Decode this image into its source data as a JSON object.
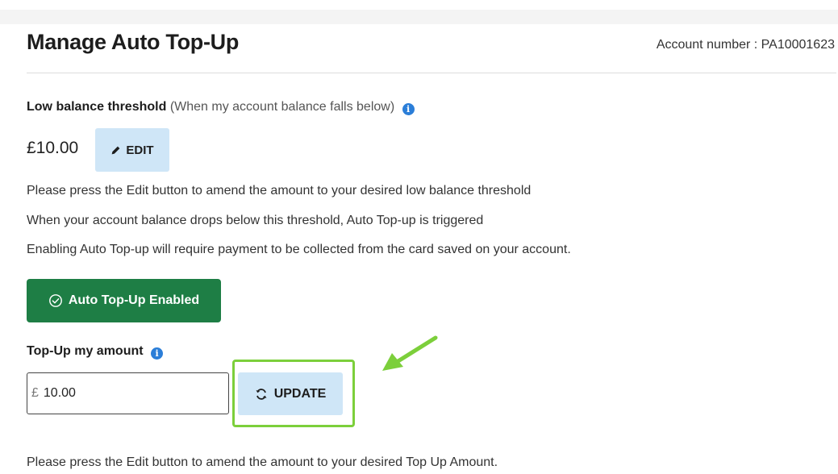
{
  "page": {
    "title": "Manage Auto Top-Up",
    "account_label": "Account number : PA10001623"
  },
  "threshold": {
    "label_bold": "Low balance threshold",
    "label_note": "(When my account balance falls below)",
    "info_icon": "info-icon",
    "amount": "£10.00",
    "edit_label": "EDIT",
    "edit_icon": "pencil-icon"
  },
  "instructions": [
    "Please press the Edit button to amend the amount to your desired low balance threshold",
    "When your account balance drops below this threshold, Auto Top-up is triggered",
    "Enabling Auto Top-up will require payment to be collected from the card saved on your account."
  ],
  "status": {
    "enabled_label": "Auto Top-Up Enabled",
    "icon": "check-circle-icon",
    "color": "#1e7e45"
  },
  "topup": {
    "label": "Top-Up my amount",
    "currency_symbol": "£",
    "value": "10.00",
    "update_label": "UPDATE",
    "update_icon": "refresh-icon",
    "highlight_color": "#7ccf3b"
  },
  "footer_text": "Please press the Edit button to amend the amount to your desired Top Up Amount."
}
